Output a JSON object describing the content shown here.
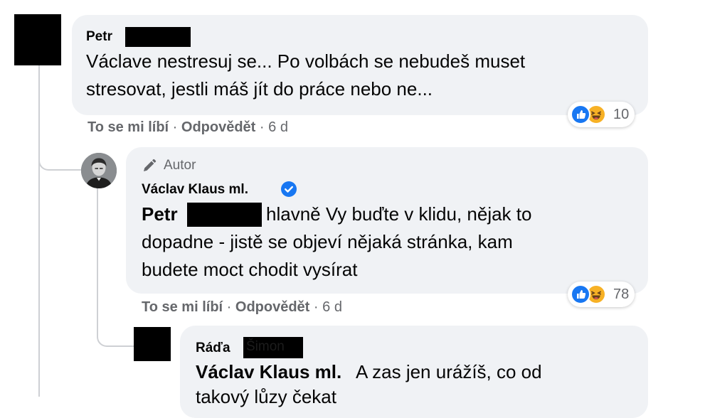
{
  "comments": [
    {
      "author_first": "Petr",
      "text_lines": [
        "Václave nestresuj se... Po volbách se nebudeš muset",
        "stresovat, jestli máš jít do práce nebo ne..."
      ],
      "actions": {
        "like": "To se mi líbí",
        "reply": "Odpovědět",
        "time": "6 d",
        "separator": "·"
      },
      "reactions": {
        "icons": [
          "like-icon",
          "haha-icon"
        ],
        "count": "10"
      }
    },
    {
      "badge": "Autor",
      "author": "Václav Klaus ml.",
      "verified": true,
      "mention": "Petr",
      "text_lines": [
        "hlavně Vy buďte v klidu, nějak to",
        "dopadne - jistě se objeví nějaká stránka, kam",
        "budete moct chodit vysírat"
      ],
      "actions": {
        "like": "To se mi líbí",
        "reply": "Odpovědět",
        "time": "6 d",
        "separator": "·"
      },
      "reactions": {
        "icons": [
          "like-icon",
          "haha-icon"
        ],
        "count": "78"
      }
    },
    {
      "author_first": "Ráďa",
      "author_last_hidden": "Šimon",
      "mention": "Václav Klaus ml.",
      "text_line1": "A zas jen urážíš, co od",
      "text_line2": "takový lůzy čekat"
    }
  ],
  "colors": {
    "bubble": "#f0f2f5",
    "secondary_text": "#65676b",
    "like_blue": "#1877f2",
    "haha_yellow": "#f7b125",
    "thread_line": "#ced0d4"
  }
}
